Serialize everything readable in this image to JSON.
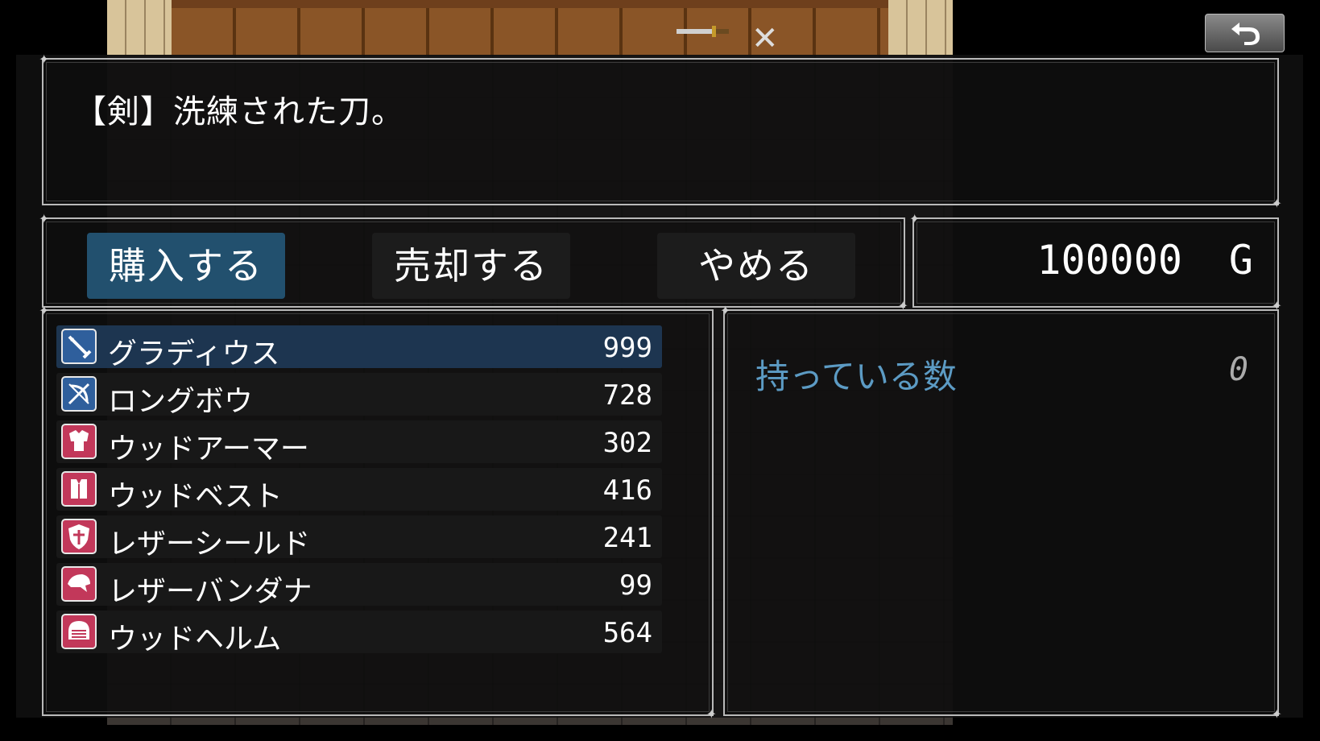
{
  "help": {
    "text": "【剣】洗練された刀。"
  },
  "commands": [
    {
      "label": "購入する",
      "selected": true
    },
    {
      "label": "売却する",
      "selected": false
    },
    {
      "label": "やめる",
      "selected": false
    }
  ],
  "gold": {
    "value": "100000",
    "unit": "G"
  },
  "items": [
    {
      "name": "グラディウス",
      "price": "999",
      "icon": "sword-icon",
      "selected": true
    },
    {
      "name": "ロングボウ",
      "price": "728",
      "icon": "bow-icon",
      "selected": false
    },
    {
      "name": "ウッドアーマー",
      "price": "302",
      "icon": "armor-icon",
      "selected": false
    },
    {
      "name": "ウッドベスト",
      "price": "416",
      "icon": "vest-icon",
      "selected": false
    },
    {
      "name": "レザーシールド",
      "price": "241",
      "icon": "shield-icon",
      "selected": false
    },
    {
      "name": "レザーバンダナ",
      "price": "99",
      "icon": "bandana-icon",
      "selected": false
    },
    {
      "name": "ウッドヘルム",
      "price": "564",
      "icon": "helmet-icon",
      "selected": false
    }
  ],
  "status": {
    "owned_label": "持っている数",
    "owned_value": "0"
  },
  "colors": {
    "selected_command": "#22506e",
    "selected_row": "#1d3550",
    "weapon_icon_bg": "#2f5f9c",
    "armor_icon_bg": "#c2385a",
    "owned_label": "#5c9bc4"
  }
}
